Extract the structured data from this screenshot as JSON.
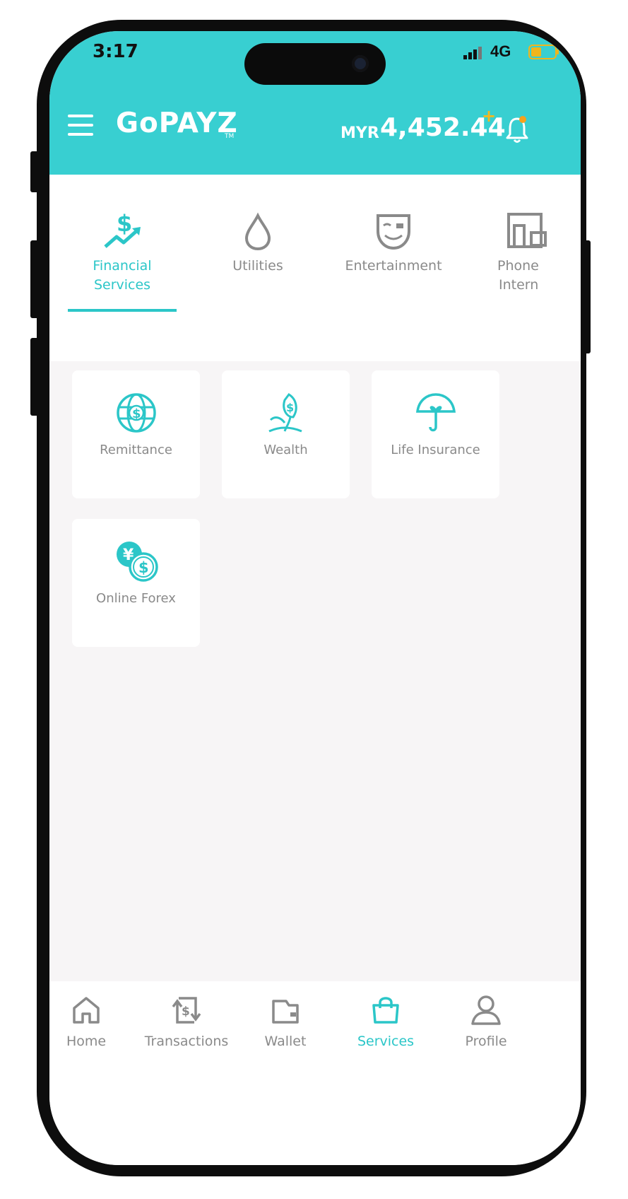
{
  "status_bar": {
    "time": "3:17",
    "network": "4G"
  },
  "header": {
    "logo": "GoPAYZ",
    "logo_tm": "TM",
    "balance_currency": "MYR",
    "balance_amount": "4,452.44",
    "balance_plus": "+",
    "accent_color": "#38cfd1"
  },
  "tabs": [
    {
      "label_line1": "Financial",
      "label_line2": "Services",
      "icon": "dollar-growth-icon",
      "active": true
    },
    {
      "label_line1": "Utilities",
      "label_line2": "",
      "icon": "water-drop-icon",
      "active": false
    },
    {
      "label_line1": "Entertainment",
      "label_line2": "",
      "icon": "mask-icon",
      "active": false
    },
    {
      "label_line1": "Phone",
      "label_line2": "Intern",
      "icon": "phone-devices-icon",
      "active": false
    }
  ],
  "services": [
    {
      "label": "Remittance",
      "icon": "globe-dollar-icon"
    },
    {
      "label": "Wealth",
      "icon": "plant-dollar-icon"
    },
    {
      "label": "Life Insurance",
      "icon": "umbrella-heart-icon"
    },
    {
      "label": "Online Forex",
      "icon": "yen-dollar-icon"
    }
  ],
  "bottom_nav": [
    {
      "label": "Home",
      "icon": "home-icon",
      "active": false
    },
    {
      "label": "Transactions",
      "icon": "transactions-icon",
      "active": false
    },
    {
      "label": "Wallet",
      "icon": "wallet-icon",
      "active": false
    },
    {
      "label": "Services",
      "icon": "shopping-bag-icon",
      "active": true
    },
    {
      "label": "Profile",
      "icon": "profile-icon",
      "active": false
    }
  ]
}
